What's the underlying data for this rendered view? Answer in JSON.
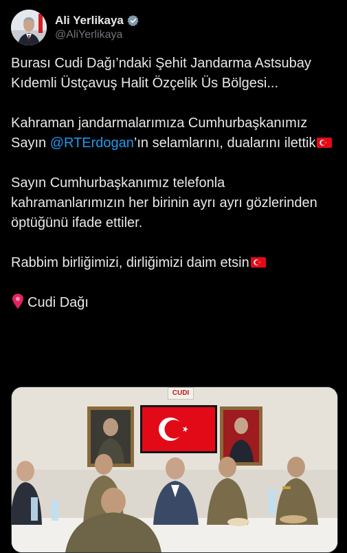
{
  "author": {
    "display_name": "Ali Yerlikaya",
    "handle": "@AliYerlikaya",
    "verified": true,
    "avatar_icon": "profile-photo"
  },
  "tweet": {
    "p1": "Burası Cudi Dağı’ndaki Şehit Jandarma Astsubay Kıdemli Üstçavuş Halit Özçelik Üs Bölgesi...",
    "p2_before": "Kahraman jandarmalarımıza Cumhurbaşkanımız Sayın ",
    "p2_mention": "@RTErdogan",
    "p2_after": "’ın selamlarını, dualarını ilettik",
    "p3": "Sayın Cumhurbaşkanımız telefonla kahramanlarımızın her birinin ayrı ayrı gözlerinden öptüğünü ifade ettiler.",
    "p4": "Rabbim birliğimizi, dirliğimizi daim etsin",
    "location": "Cudi Dağı"
  },
  "photo": {
    "sign_text": "CUDI",
    "description_icon": "meeting-photo"
  },
  "colors": {
    "background": "#000000",
    "text": "#e7e9ea",
    "secondary": "#71767b",
    "link": "#1d9bf0",
    "flag_red": "#e30a17"
  }
}
